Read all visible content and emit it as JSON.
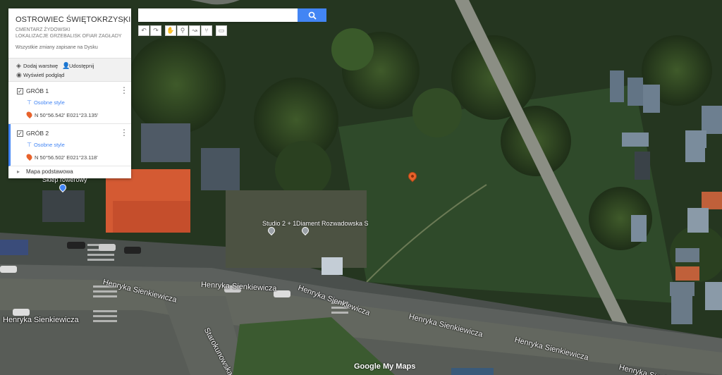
{
  "map_title": "OSTROWIEC ŚWIĘTOKRZYSKI",
  "map_description": "CMENTARZ ŻYDOWSKI\nLOKALIZACJE GRZEBALISK OFIAR ZAGŁADY",
  "save_status": "Wszystkie zmiany zapisane na Dysku",
  "actions": {
    "add_layer": "Dodaj warstwę",
    "share": "Udostępnij",
    "preview": "Wyświetl podgląd"
  },
  "layers": [
    {
      "name": "GRÓB 1",
      "style": "Osobne style",
      "coord": "N 50°56.542' E021°23.135'",
      "checked": "✓"
    },
    {
      "name": "GRÓB 2",
      "style": "Osobne style",
      "coord": "N 50°56.502' E021°23.118'",
      "checked": "✓"
    }
  ],
  "base_map": "Mapa podstawowa",
  "search": {
    "placeholder": "",
    "value": ""
  },
  "streets": {
    "s1": "Henryka Sienkiewicza",
    "s2": "Henryka Sienkiewicza",
    "s3": "Henryka Sienkiewicza",
    "s4": "Henryka Sienkiewicza",
    "s5": "Henryka Sienkiewicza",
    "s6": "Henryka Sienkiewicza",
    "s7": "Henryka Sienkiewicza",
    "s8": "Starokunowska"
  },
  "pois": {
    "p1": "Studio 2 + 1",
    "p2": "Diament Rozwadowska S",
    "p3": "Sklep rowerowy"
  },
  "logo": "Google My Maps",
  "colors": {
    "accent": "#4285f4",
    "marker": "#e8622b"
  }
}
